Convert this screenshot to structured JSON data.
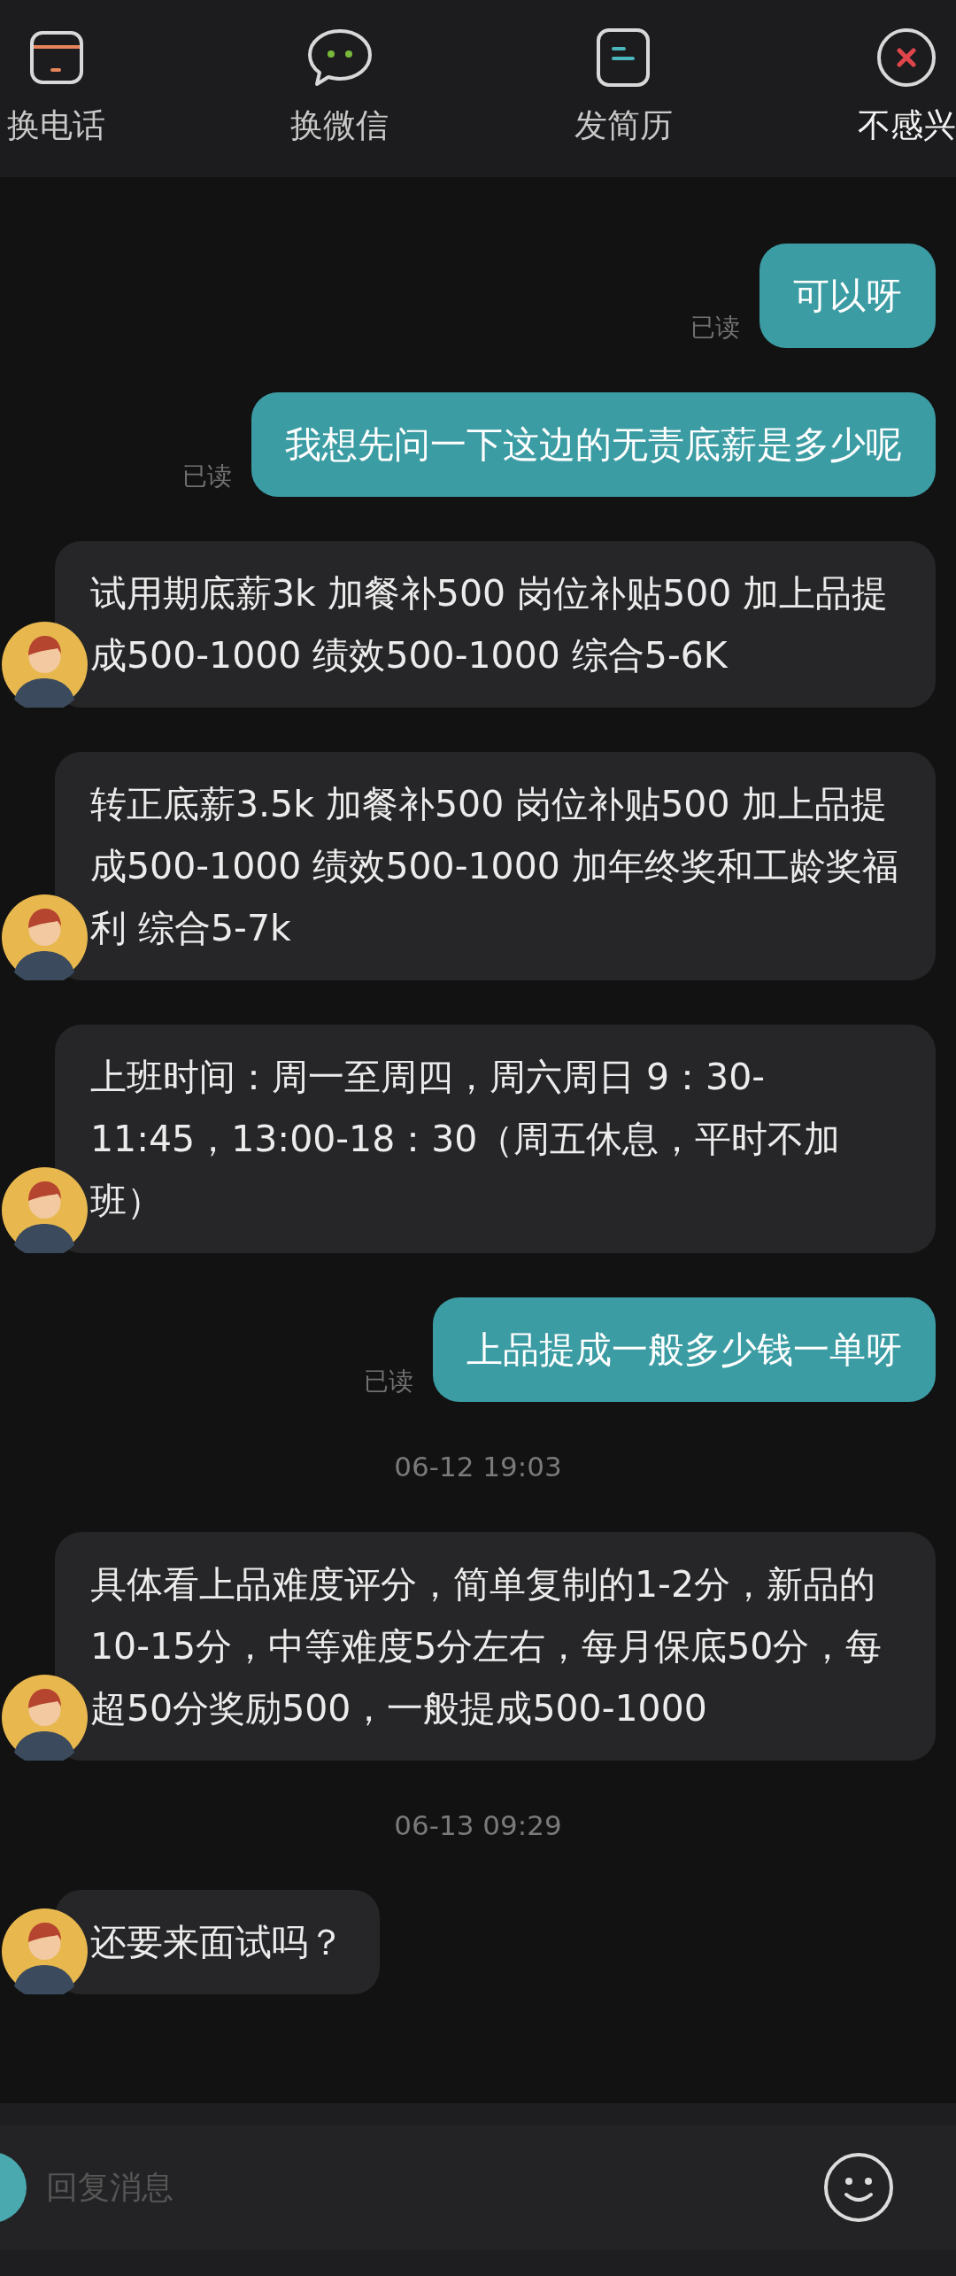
{
  "actions": [
    {
      "kind": "phone",
      "label": "换电话"
    },
    {
      "kind": "wechat",
      "label": "换微信"
    },
    {
      "kind": "resume",
      "label": "发简历"
    },
    {
      "kind": "reject",
      "label": "不感兴"
    }
  ],
  "messages": [
    {
      "kind": "sent",
      "text": "可以呀",
      "status": "已读"
    },
    {
      "kind": "sent",
      "text": "我想先问一下这边的无责底薪是多少呢",
      "status": "已读"
    },
    {
      "kind": "received",
      "text": "试用期底薪3k 加餐补500 岗位补贴500 加上品提成500-1000 绩效500-1000 综合5-6K"
    },
    {
      "kind": "received",
      "text": "转正底薪3.5k 加餐补500 岗位补贴500 加上品提成500-1000  绩效500-1000 加年终奖和工龄奖福利 综合5-7k"
    },
    {
      "kind": "received",
      "text": "上班时间：周一至周四，周六周日 9：30-11:45，13:00-18：30（周五休息，平时不加班）"
    },
    {
      "kind": "sent",
      "text": "上品提成一般多少钱一单呀",
      "status": "已读"
    },
    {
      "kind": "timestamp",
      "text": "06-12 19:03"
    },
    {
      "kind": "received",
      "text": "具体看上品难度评分，简单复制的1-2分，新品的10-15分，中等难度5分左右，每月保底50分，每超50分奖励500，一般提成500-1000"
    },
    {
      "kind": "timestamp",
      "text": "06-13 09:29"
    },
    {
      "kind": "received",
      "text": "还要来面试吗？"
    }
  ],
  "composer": {
    "placeholder": "回复消息"
  }
}
